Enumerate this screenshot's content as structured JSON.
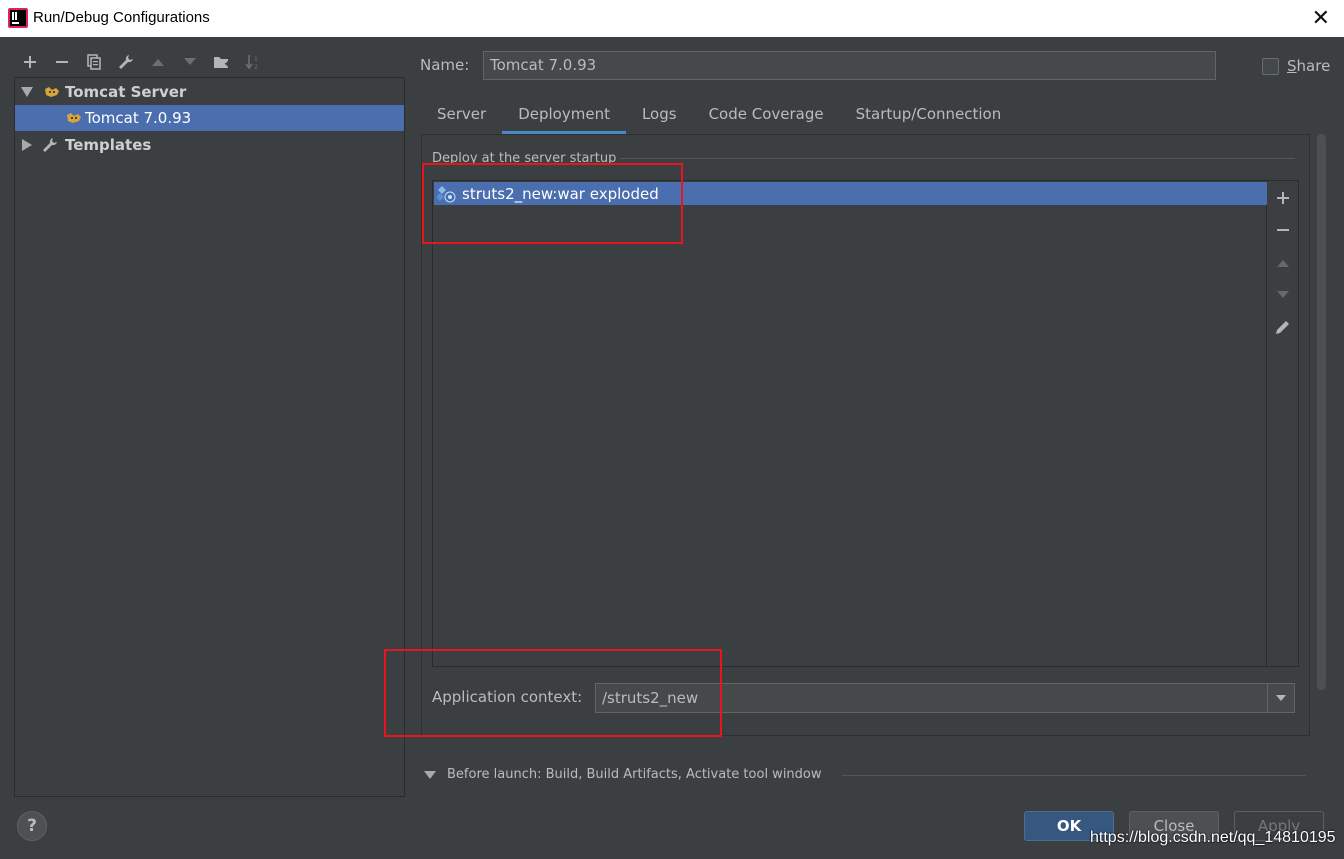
{
  "window": {
    "title": "Run/Debug Configurations",
    "close_glyph": "✕"
  },
  "toolbar": {
    "icons": [
      "plus-icon",
      "minus-icon",
      "copy-icon",
      "wrench-icon",
      "arrow-up-icon",
      "arrow-down-icon",
      "folder-add-icon",
      "sort-icon"
    ]
  },
  "tree": {
    "group": "Tomcat Server",
    "child": "Tomcat 7.0.93",
    "templates": "Templates"
  },
  "name_field": {
    "label": "Name:",
    "value": "Tomcat 7.0.93"
  },
  "share": {
    "label": "Share",
    "checked": false
  },
  "tabs": [
    {
      "label": "Server"
    },
    {
      "label": "Deployment",
      "active": true
    },
    {
      "label": "Logs"
    },
    {
      "label": "Code Coverage"
    },
    {
      "label": "Startup/Connection"
    }
  ],
  "deployment": {
    "header": "Deploy at the server startup",
    "items": [
      "struts2_new:war exploded"
    ]
  },
  "app_context": {
    "label": "Application context:",
    "value": "/struts2_new"
  },
  "before_launch": "Before launch: Build, Build Artifacts, Activate tool window",
  "buttons": {
    "help": "?",
    "ok": "OK",
    "close": "Close",
    "apply": "Apply"
  },
  "watermark": "https://blog.csdn.net/qq_14810195",
  "colors": {
    "selection": "#4b6eaf",
    "background": "#3c3f41",
    "highlight_box": "#e5161e",
    "accent": "#4a88c7"
  }
}
